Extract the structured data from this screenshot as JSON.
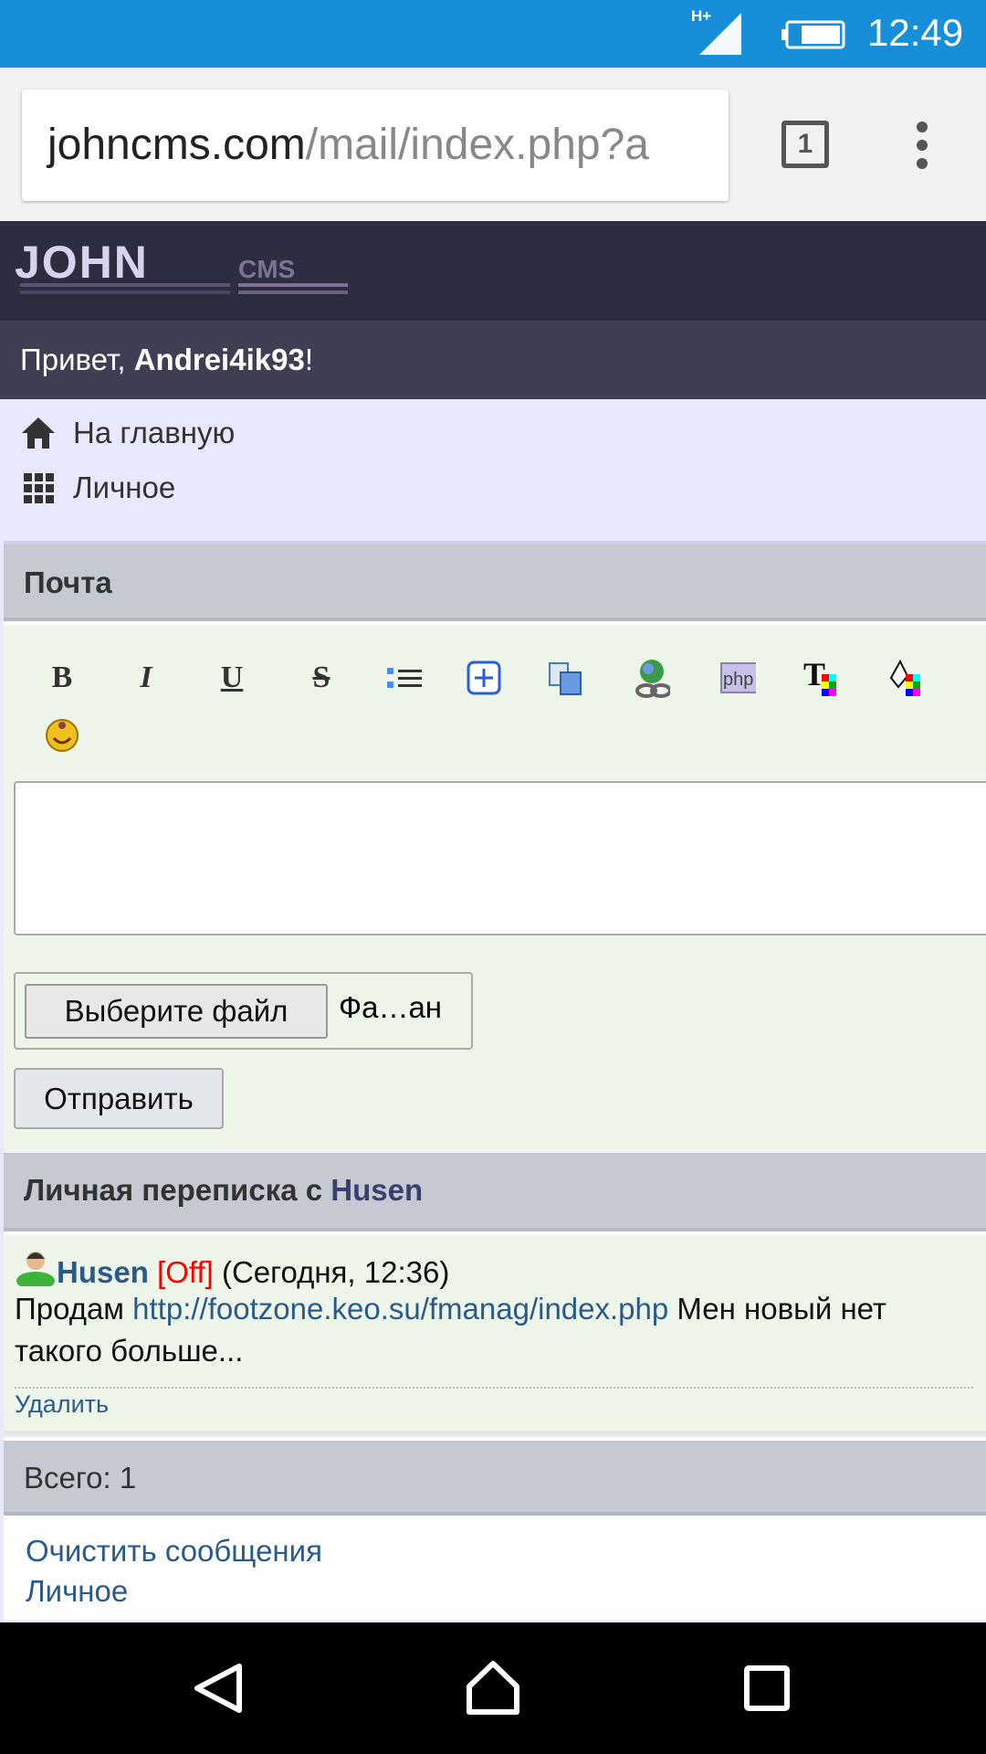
{
  "status_bar": {
    "network": "H+",
    "time": "12:49"
  },
  "browser": {
    "url_host": "johncms.com",
    "url_path": "/mail/index.php?a",
    "tab_count": "1"
  },
  "site": {
    "logo": "JOHN CMS",
    "greeting_prefix": "Привет, ",
    "username": "Andrei4ik93",
    "greeting_suffix": "!"
  },
  "nav": [
    {
      "label": "На главную",
      "icon": "home-icon"
    },
    {
      "label": "Личное",
      "icon": "grid-icon"
    }
  ],
  "mail": {
    "title": "Почта",
    "toolbar": [
      "bold",
      "italic",
      "underline",
      "strikethrough",
      "list",
      "spoiler",
      "quote",
      "url",
      "php",
      "text-color",
      "bg-color",
      "smileys"
    ],
    "textarea_value": "",
    "file_button": "Выберите файл",
    "file_status": "Фа…ан",
    "send": "Отправить"
  },
  "conversation": {
    "title_prefix": "Личная переписка с ",
    "partner": "Husen",
    "messages": [
      {
        "author": "Husen",
        "status": "[Off]",
        "time": "(Сегодня, 12:36)",
        "text_before": "Продам ",
        "link": "http://footzone.keo.su/fmanag/index.php",
        "text_after": " Мен новый нет такого больше...",
        "delete": "Удалить"
      }
    ]
  },
  "total": "Всего: 1",
  "footer_links": [
    "Очистить сообщения",
    "Личное"
  ],
  "colors": {
    "status": "#168fd8",
    "header": "#2d2d42",
    "link": "#2a5a8c",
    "offline": "#ff0000"
  }
}
